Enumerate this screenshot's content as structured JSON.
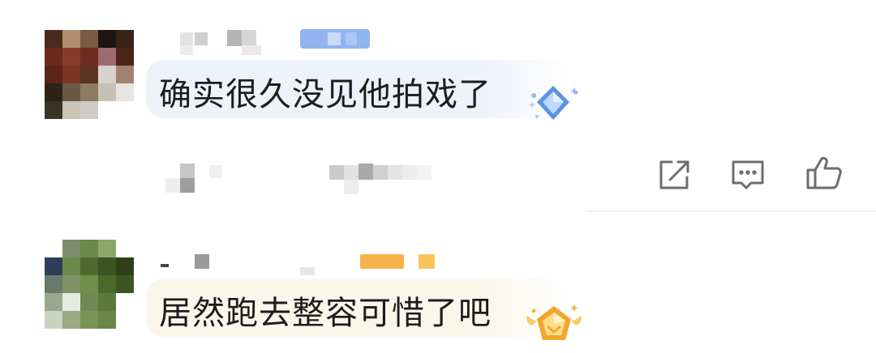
{
  "comments": [
    {
      "text": "确实很久没见他拍戏了",
      "badge_icon": "blue-diamond-badge-icon",
      "bubble_color": "#eef2fb"
    },
    {
      "text": "居然跑去整容可惜了吧",
      "badge_icon": "gold-crown-badge-icon",
      "bubble_color": "#fbf6ea"
    }
  ],
  "actions": [
    {
      "icon": "share-icon"
    },
    {
      "icon": "reply-icon"
    },
    {
      "icon": "like-icon"
    }
  ]
}
